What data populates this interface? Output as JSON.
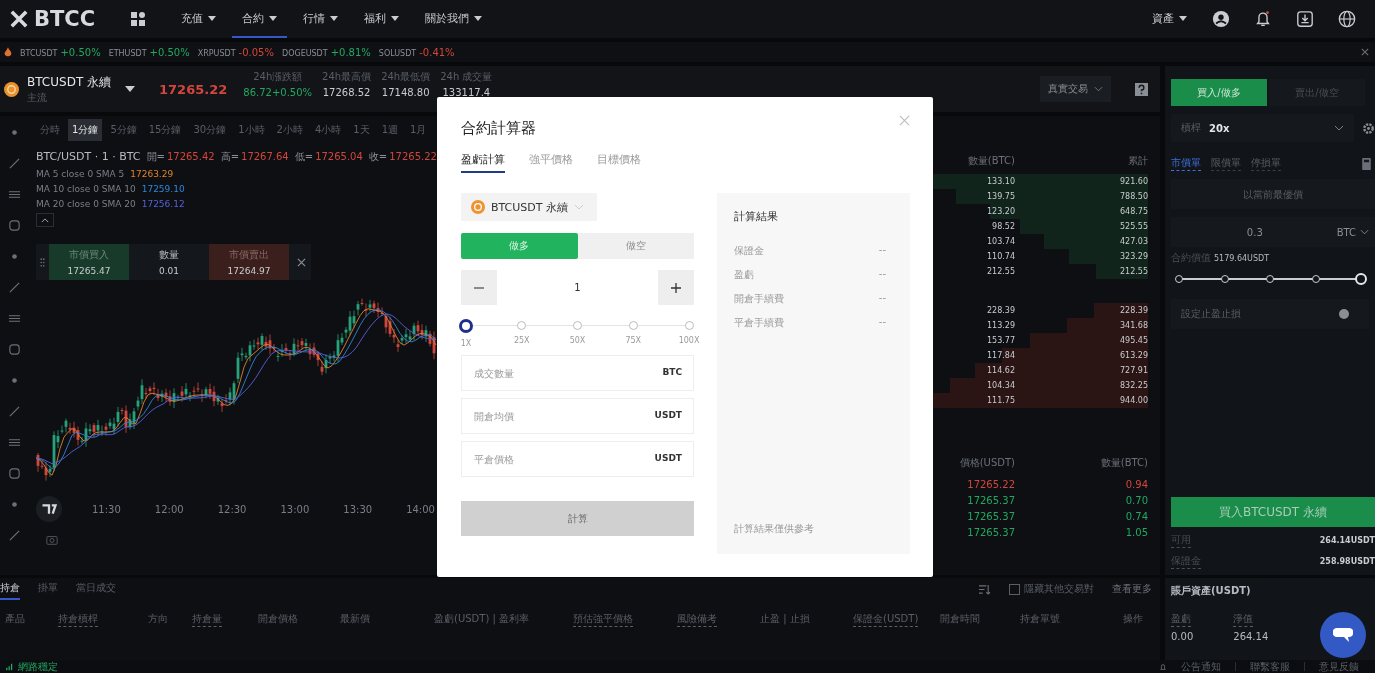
{
  "nav": {
    "logo": "BTCC",
    "items": [
      {
        "label": "充值",
        "selected": false
      },
      {
        "label": "合約",
        "selected": true
      },
      {
        "label": "行情",
        "selected": false
      },
      {
        "label": "福利",
        "selected": false
      },
      {
        "label": "關於我們",
        "selected": false
      }
    ],
    "assets_menu": "資產"
  },
  "ticker": [
    {
      "symbol": "BTCUSDT",
      "change": "+0.50%",
      "color": "#22a861"
    },
    {
      "symbol": "ETHUSDT",
      "change": "+0.50%",
      "color": "#22a861"
    },
    {
      "symbol": "XRPUSDT",
      "change": "-0.05%",
      "color": "#d2463c"
    },
    {
      "symbol": "DOGEUSDT",
      "change": "+0.81%",
      "color": "#22a861"
    },
    {
      "symbol": "SOLUSDT",
      "change": "-0.41%",
      "color": "#d2463c"
    }
  ],
  "symbol_header": {
    "symbol": "BTCUSDT 永續",
    "category": "主流",
    "price": {
      "value": "17265.22",
      "color": "#d2463c"
    },
    "stats": [
      {
        "label": "24h漲跌額",
        "value": "86.72+0.50%",
        "color": "#22a861"
      },
      {
        "label": "24h最高價",
        "value": "17268.52",
        "color": "#c9ccd1"
      },
      {
        "label": "24h最低價",
        "value": "17148.80",
        "color": "#c9ccd1"
      },
      {
        "label": "24h 成交量",
        "value": "133117.4",
        "color": "#c9ccd1"
      }
    ],
    "account_mode": "真實交易"
  },
  "chart": {
    "intervals": [
      {
        "label": "分時",
        "selected": false
      },
      {
        "label": "1分鐘",
        "selected": true
      },
      {
        "label": "5分鐘",
        "selected": false
      },
      {
        "label": "15分鐘",
        "selected": false
      },
      {
        "label": "30分鐘",
        "selected": false
      },
      {
        "label": "1小時",
        "selected": false
      },
      {
        "label": "2小時",
        "selected": false
      },
      {
        "label": "4小時",
        "selected": false
      },
      {
        "label": "1天",
        "selected": false
      },
      {
        "label": "1週",
        "selected": false
      },
      {
        "label": "1月",
        "selected": false
      }
    ],
    "legend": {
      "pair": "BTC/USDT · 1 · BTC",
      "ohlc": [
        {
          "label": "開=",
          "value": "17265.42",
          "color": "#d2463c"
        },
        {
          "label": "高=",
          "value": "17267.64",
          "color": "#d2463c"
        },
        {
          "label": "低=",
          "value": "17265.04",
          "color": "#d2463c"
        },
        {
          "label": "收=",
          "value": "17265.22",
          "color": "#d2463c"
        }
      ]
    },
    "ma": [
      {
        "label": "MA 5 close 0 SMA 5",
        "value": "17263.29",
        "color": "#e0822e"
      },
      {
        "label": "MA 10 close 0 SMA 10",
        "value": "17259.10",
        "color": "#2f86d8"
      },
      {
        "label": "MA 20 close 0 SMA 20",
        "value": "17256.12",
        "color": "#5561d6"
      }
    ],
    "quick_trade": {
      "buy_label": "市價買入",
      "buy_price": "17265.47",
      "qty_label": "數量",
      "qty": "0.01",
      "sell_label": "市價賣出",
      "sell_price": "17264.97"
    },
    "time_axis": [
      "11:30",
      "12:00",
      "12:30",
      "13:00",
      "13:30",
      "14:00"
    ]
  },
  "order_book": {
    "columns": [
      "數量(BTC)",
      "累計"
    ],
    "groups": [
      {
        "color": "#10241b",
        "rows": [
          {
            "qty": "133.10",
            "total": "921.60"
          },
          {
            "qty": "139.75",
            "total": "788.50"
          },
          {
            "qty": "123.20",
            "total": "648.75"
          },
          {
            "qty": "98.52",
            "total": "525.55"
          },
          {
            "qty": "103.74",
            "total": "427.03"
          },
          {
            "qty": "110.74",
            "total": "323.29"
          },
          {
            "qty": "212.55",
            "total": "212.55"
          }
        ]
      },
      {
        "color": "#2a1414",
        "rows": [
          {
            "qty": "228.39",
            "total": "228.39"
          },
          {
            "qty": "113.29",
            "total": "341.68"
          },
          {
            "qty": "153.77",
            "total": "495.45"
          },
          {
            "qty": "117.84",
            "total": "613.29"
          },
          {
            "qty": "114.62",
            "total": "727.91"
          },
          {
            "qty": "104.34",
            "total": "832.25"
          },
          {
            "qty": "111.75",
            "total": "944.00"
          }
        ]
      }
    ]
  },
  "trades": {
    "columns": [
      "價格(USDT)",
      "數量(BTC)"
    ],
    "rows": [
      {
        "price": "17265.22",
        "qty": "0.94",
        "color": "#d2463c"
      },
      {
        "price": "17265.37",
        "qty": "0.70",
        "color": "#22a861"
      },
      {
        "price": "17265.37",
        "qty": "0.74",
        "color": "#22a861"
      },
      {
        "price": "17265.37",
        "qty": "1.05",
        "color": "#22a861"
      }
    ]
  },
  "trade_panel": {
    "sides": [
      {
        "label": "買入/做多",
        "selected": true
      },
      {
        "label": "賣出/做空",
        "selected": false
      }
    ],
    "leverage_label": "槓桿",
    "leverage": "20x",
    "order_types": [
      {
        "label": "市價單",
        "selected": true
      },
      {
        "label": "限價單",
        "selected": false
      },
      {
        "label": "停損單",
        "selected": false
      }
    ],
    "price_placeholder": "以當前最優價",
    "quantity": "0.3",
    "quantity_unit": "BTC",
    "contract_value_label": "合約價值",
    "contract_value": "5179.64USDT",
    "amount_slider": {
      "level": 1
    },
    "tp_sl": {
      "label": "設定止盈止損",
      "on": false
    },
    "submit": "買入BTCUSDT 永續",
    "balances": [
      {
        "label": "可用",
        "value": "264.14USDT"
      },
      {
        "label": "保證金",
        "value": "258.98USDT"
      }
    ]
  },
  "positions": {
    "tabs": [
      {
        "label": "持倉",
        "selected": true
      },
      {
        "label": "掛單",
        "selected": false
      },
      {
        "label": "當日成交",
        "selected": false
      }
    ],
    "hide_other_pairs": {
      "label": "隱藏其他交易對",
      "checked": false
    },
    "more": "查看更多",
    "columns": [
      {
        "label": "產品",
        "hint": false
      },
      {
        "label": "持倉槓桿",
        "hint": true
      },
      {
        "label": "方向",
        "hint": false
      },
      {
        "label": "持倉量",
        "hint": true
      },
      {
        "label": "開倉價格",
        "hint": false
      },
      {
        "label": "最新價",
        "hint": false
      },
      {
        "label": "盈虧(USDT) | 盈利率",
        "hint": false
      },
      {
        "label": "預估強平價格",
        "hint": true
      },
      {
        "label": "風險備考",
        "hint": true
      },
      {
        "label": "止盈 | 止損",
        "hint": false
      },
      {
        "label": "保證金(USDT)",
        "hint": true
      },
      {
        "label": "開倉時間",
        "hint": false
      },
      {
        "label": "持倉單號",
        "hint": false
      },
      {
        "label": "操作",
        "hint": false
      }
    ]
  },
  "account": {
    "title": "賬戶資產(USDT)",
    "items": [
      {
        "label": "盈虧",
        "value": "0.00"
      },
      {
        "label": "淨值",
        "value": "264.14"
      }
    ]
  },
  "status_bar": {
    "network": "網路穩定",
    "links": [
      "公告通知",
      "聯繫客服",
      "意見反饋"
    ]
  },
  "calculator": {
    "title": "合約計算器",
    "tabs": [
      {
        "label": "盈虧計算",
        "selected": true
      },
      {
        "label": "強平價格",
        "selected": false
      },
      {
        "label": "目標價格",
        "selected": false
      }
    ],
    "symbol": "BTCUSDT 永續",
    "sides": [
      {
        "label": "做多",
        "selected": true
      },
      {
        "label": "做空",
        "selected": false
      }
    ],
    "leverage_value": "1",
    "leverage_marks": [
      {
        "label": "1X",
        "selected": true
      },
      {
        "label": "25X",
        "selected": false
      },
      {
        "label": "50X",
        "selected": false
      },
      {
        "label": "75X",
        "selected": false
      },
      {
        "label": "100X",
        "selected": false
      }
    ],
    "inputs": [
      {
        "placeholder": "成交數量",
        "unit": "BTC"
      },
      {
        "placeholder": "開倉均價",
        "unit": "USDT"
      },
      {
        "placeholder": "平倉價格",
        "unit": "USDT"
      }
    ],
    "submit": {
      "label": "計算",
      "disabled": true
    },
    "results_title": "計算結果",
    "results": [
      {
        "label": "保證金",
        "value": "--"
      },
      {
        "label": "盈虧",
        "value": "--"
      },
      {
        "label": "開倉手續費",
        "value": "--"
      },
      {
        "label": "平倉手續費",
        "value": "--"
      }
    ],
    "note": "計算結果僅供參考"
  }
}
